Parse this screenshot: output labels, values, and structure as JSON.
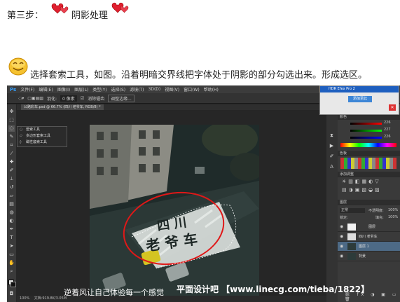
{
  "heading": {
    "step": "第三步：",
    "title": "阴影处理"
  },
  "instruction": "选择套索工具，如图。沿着明暗交界线把字体处于阴影的部分勾选出来。形成选区。",
  "photoshop": {
    "logo": "Ps",
    "menu": [
      "文件(F)",
      "编辑(E)",
      "图像(I)",
      "图层(L)",
      "类型(Y)",
      "选择(S)",
      "滤镜(T)",
      "3D(D)",
      "视图(V)",
      "窗口(W)",
      "帮助(H)"
    ],
    "options": {
      "feather_label": "羽化:",
      "feather_value": "0 像素",
      "antialias": "消除锯齿",
      "refine_edge": "调整边缘..."
    },
    "document_tab": "公路彩车.psd @ 66.7% (四川 老爷车, RGB/8) *",
    "lasso_flyout": [
      "套索工具",
      "多边形套索工具",
      "磁性套索工具"
    ],
    "canvas_text": {
      "line1": "四 川",
      "line2": "老 爷 车"
    },
    "status": {
      "zoom": "100%",
      "doc": "文档:919.8K/3.05M"
    },
    "hdr_popup": {
      "title": "HDR Efex Pro 2",
      "button": "添加至此"
    },
    "color_panel": {
      "r": "226",
      "g": "227",
      "b": "226"
    },
    "swatches_head": "色板",
    "adjust_head": "添加调整",
    "layers": {
      "head": "图层",
      "blend_mode": "正常",
      "opacity_label": "不透明度:",
      "opacity_value": "100%",
      "lock_label": "锁定:",
      "fill_label": "填充:",
      "fill_value": "100%",
      "items": [
        "图层",
        "四川 老爷车",
        "图层 1",
        "背景"
      ]
    }
  },
  "watermark": {
    "left": "逆着风让自己体验每一个感觉",
    "right": "平面设计吧 【www.linecg.com/tieba/1822】"
  }
}
